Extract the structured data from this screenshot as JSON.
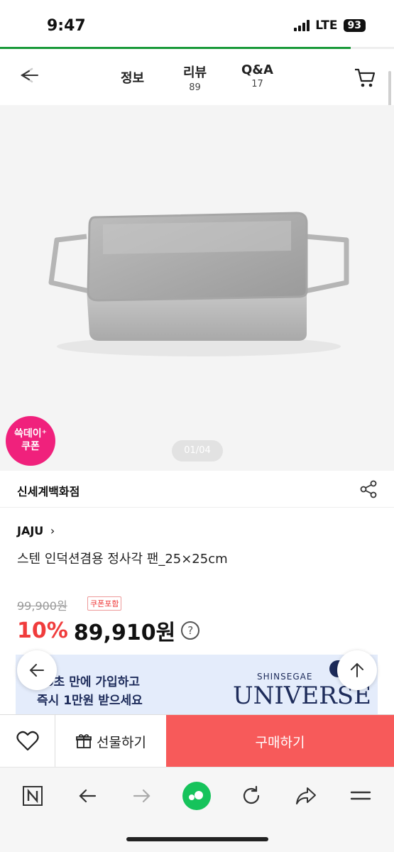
{
  "status_bar": {
    "time": "9:47",
    "network": "LTE",
    "battery": "93",
    "page_load_progress": 0.89
  },
  "header": {
    "tabs": [
      {
        "label": "정보",
        "count": ""
      },
      {
        "label": "리뷰",
        "count": "89"
      },
      {
        "label": "Q&A",
        "count": "17"
      }
    ]
  },
  "product_image": {
    "counter": "01/04"
  },
  "coupon_badge": {
    "line1": "쓱데이⁺",
    "line2": "쿠폰"
  },
  "store": {
    "name": "신세계백화점"
  },
  "product": {
    "brand": "JAJU",
    "brand_chevron": "›",
    "title": "스텐 인덕션겸용 정사각 팬_25×25cm",
    "original_price": "99,900원",
    "coupon_tag": "쿠폰포함",
    "discount": "10%",
    "price": "89,910원",
    "help_symbol": "?"
  },
  "banner": {
    "line1": "10초 만에 가입하고",
    "line2": "즉시 1만원 받으세요",
    "brand_small": "SHINSEGAE",
    "brand_large": "UNIVERSE"
  },
  "action_bar": {
    "gift_label": "선물하기",
    "buy_label": "구매하기"
  },
  "colors": {
    "accent_red": "#f03c3c",
    "buy_button": "#f75a5a",
    "coupon_pink": "#f0217c",
    "progress_green": "#1a9a3a",
    "banner_navy": "#1d2b5a"
  }
}
